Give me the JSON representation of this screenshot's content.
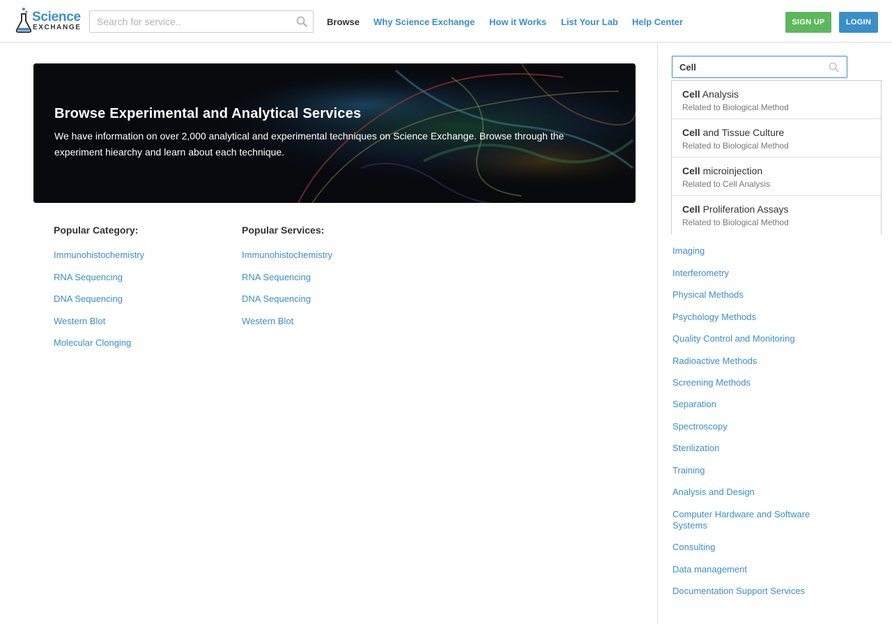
{
  "header": {
    "logo": {
      "top": "Science",
      "bottom": "EXCHANGE"
    },
    "search": {
      "placeholder": "Search for service.."
    },
    "nav": [
      {
        "label": "Browse",
        "active": true
      },
      {
        "label": "Why Science Exchange",
        "active": false
      },
      {
        "label": "How it Works",
        "active": false
      },
      {
        "label": "List Your Lab",
        "active": false
      },
      {
        "label": "Help Center",
        "active": false
      }
    ],
    "signup_label": "SIGN UP",
    "login_label": "LOGIN"
  },
  "hero": {
    "title": "Browse Experimental and Analytical Services",
    "text": "We have information on over 2,000 analytical and experimental techniques on Science Exchange. Browse through the experiment hiearchy and learn about each technique."
  },
  "popular_category": {
    "title": "Popular Category:",
    "items": [
      "Immunohistochemistry",
      "RNA Sequencing",
      "DNA Sequencing",
      "Western Blot",
      "Molecular Clonging"
    ]
  },
  "popular_services": {
    "title": "Popular Services:",
    "items": [
      "Immunohistochemistry",
      "RNA Sequencing",
      "DNA Sequencing",
      "Western Blot"
    ]
  },
  "sidebar": {
    "search_value": "Cell",
    "suggestions": [
      {
        "match": "Cell",
        "rest": " Analysis",
        "related": "Related to Biological Method"
      },
      {
        "match": "Cell",
        "rest": " and Tissue Culture",
        "related": "Related to Biological Method"
      },
      {
        "match": "Cell",
        "rest": " microinjection",
        "related": "Related to Cell Analysis"
      },
      {
        "match": "Cell",
        "rest": " Proliferation Assays",
        "related": "Related to Biological Method"
      }
    ],
    "categories": [
      "Imaging",
      "Interferometry",
      "Physical Methods",
      "Psychology Methods",
      "Quality Control and Monitoring",
      "Radioactive Methods",
      "Screening Methods",
      "Separation",
      "Spectroscopy",
      "Sterilization",
      "Training",
      "Analysis and Design",
      "Computer Hardware and Software Systems",
      "Consulting",
      "Data management",
      "Documentation Support Services"
    ]
  },
  "colors": {
    "brand_blue": "#3a8fc9",
    "signup_green": "#5cb85c",
    "text_dark": "#333333",
    "text_muted": "#777777"
  }
}
